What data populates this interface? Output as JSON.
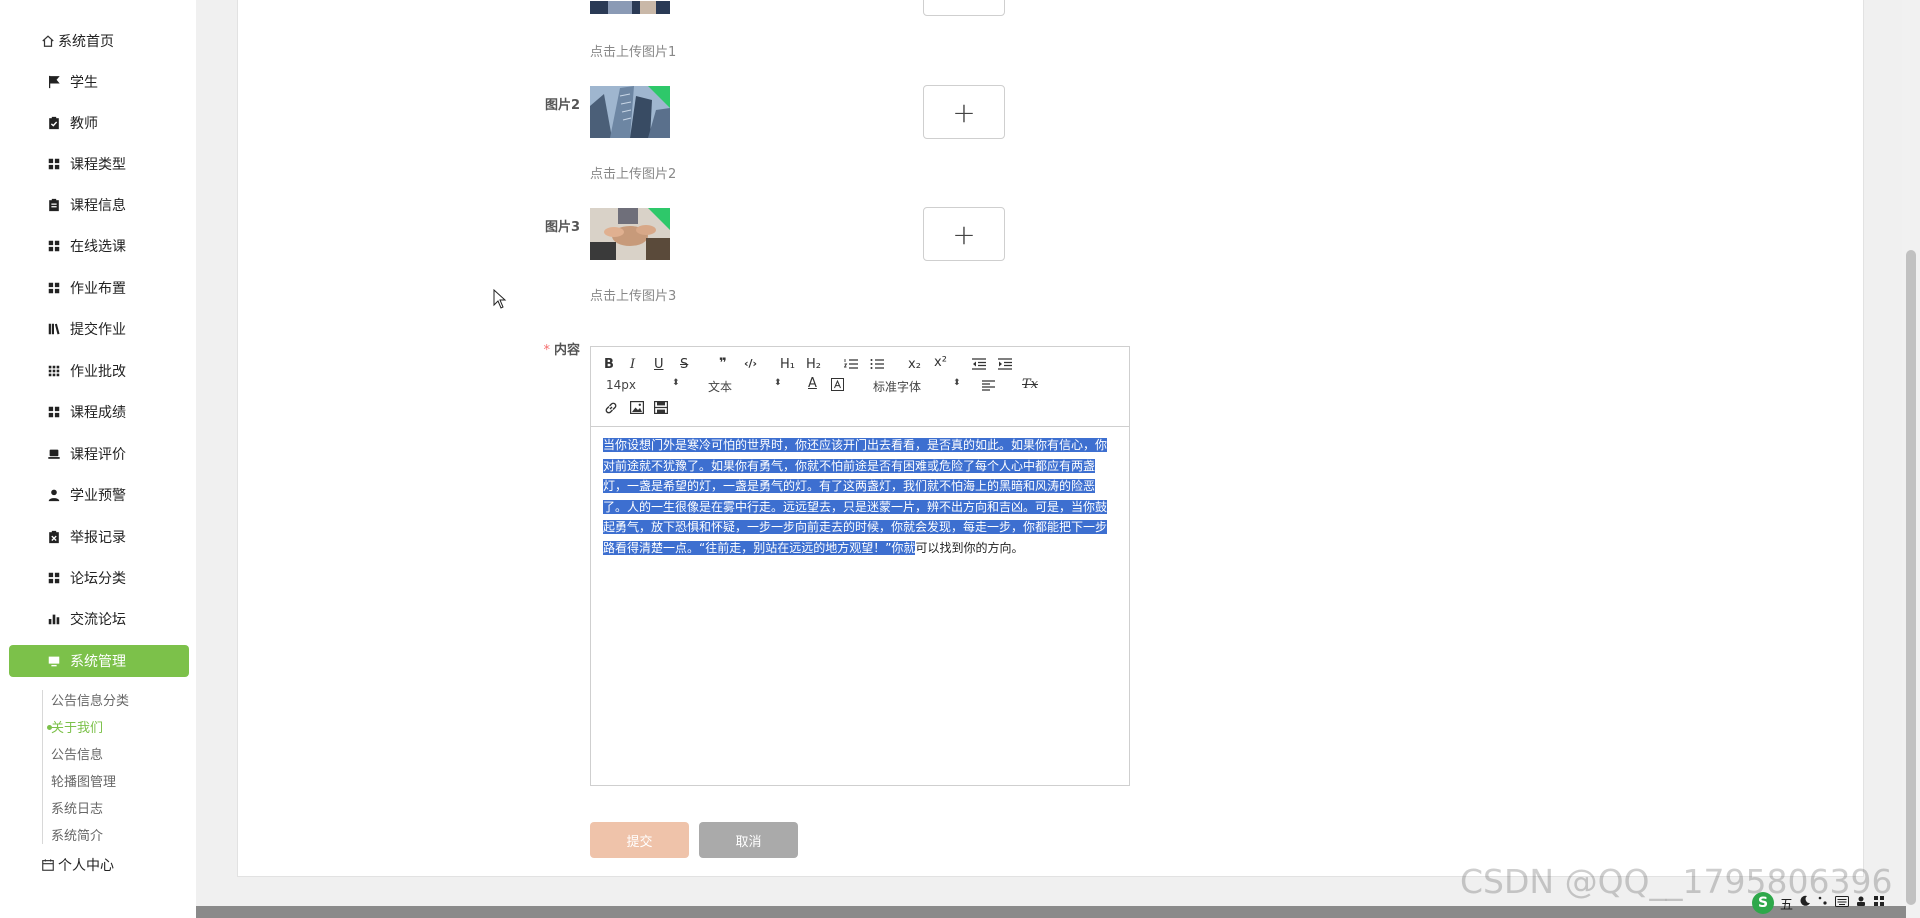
{
  "sidebar": {
    "items": [
      {
        "label": "系统首页",
        "icon": "home-icon"
      },
      {
        "label": "学生",
        "icon": "flag-icon"
      },
      {
        "label": "教师",
        "icon": "clipboard-check-icon"
      },
      {
        "label": "课程类型",
        "icon": "grid-icon"
      },
      {
        "label": "课程信息",
        "icon": "clipboard-icon"
      },
      {
        "label": "在线选课",
        "icon": "grid-icon"
      },
      {
        "label": "作业布置",
        "icon": "grid-icon"
      },
      {
        "label": "提交作业",
        "icon": "library-icon"
      },
      {
        "label": "作业批改",
        "icon": "apps-icon"
      },
      {
        "label": "课程成绩",
        "icon": "grid-icon"
      },
      {
        "label": "课程评价",
        "icon": "laptop-icon"
      },
      {
        "label": "学业预警",
        "icon": "user-icon"
      },
      {
        "label": "举报记录",
        "icon": "clipboard-x-icon"
      },
      {
        "label": "论坛分类",
        "icon": "grid-icon"
      },
      {
        "label": "交流论坛",
        "icon": "bar-chart-icon"
      },
      {
        "label": "系统管理",
        "icon": "monitor-icon"
      }
    ],
    "sub_items": [
      {
        "label": "公告信息分类"
      },
      {
        "label": "关于我们"
      },
      {
        "label": "公告信息"
      },
      {
        "label": "轮播图管理"
      },
      {
        "label": "系统日志"
      },
      {
        "label": "系统简介"
      }
    ],
    "personal_center": {
      "label": "个人中心",
      "icon": "calendar-icon"
    }
  },
  "form": {
    "image1_hint": "点击上传图片1",
    "image2": {
      "label": "图片2",
      "hint": "点击上传图片2",
      "add_symbol": "+"
    },
    "image3": {
      "label": "图片3",
      "hint": "点击上传图片3",
      "add_symbol": "+"
    },
    "content_label": "内容",
    "required_mark": "*"
  },
  "editor": {
    "toolbar": {
      "bold": "B",
      "italic": "I",
      "underline": "U",
      "strike": "S",
      "quote": "❞",
      "code": "‹/›",
      "h1": "H₁",
      "h2": "H₂",
      "ordered_list_icon": "ordered-list-icon",
      "bullet_list_icon": "bullet-list-icon",
      "subscript": "x₂",
      "superscript": "x²",
      "font_size": "14px",
      "text_style": "文本",
      "font_family": "标准字体",
      "color_letter": "A",
      "clear_format": "Tx"
    },
    "content_selected": "当你设想门外是寒冷可怕的世界时，你还应该开门出去看看，是否真的如此。如果你有信心，你对前途就不犹豫了。如果你有勇气，你就不怕前途是否有困难或危险了每个人心中都应有两盏灯，一盏是希望的灯，一盏是勇气的灯。有了这两盏灯，我们就不怕海上的黑暗和风涛的险恶了。人的一生很像是在雾中行走。远远望去，只是迷蒙一片，辨不出方向和吉凶。可是，当你鼓起勇气，放下恐惧和怀疑，一步一步向前走去的时候，你就会发现，每走一步，你都能把下一步路看得清楚一点。“往前走，别站在远远的地方观望！”你就",
    "content_rest": "可以找到你的方向。"
  },
  "buttons": {
    "submit": "提交",
    "cancel": "取消"
  },
  "watermark": "CSDN @QQ__1795806396",
  "tray": {
    "ime": "五",
    "logo_letter": "S"
  },
  "colors": {
    "accent": "#7cc14a",
    "selection": "#3d6fd0",
    "submit": "#efc3aa",
    "cancel": "#aaaaaa",
    "required": "#f56c6c"
  }
}
